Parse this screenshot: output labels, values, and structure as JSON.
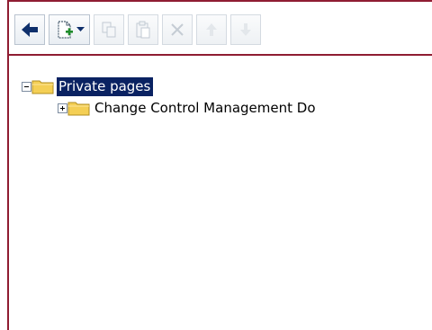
{
  "toolbar": {
    "buttons": [
      {
        "name": "back-button",
        "icon": "arrow-left-icon",
        "enabled": true
      },
      {
        "name": "new-page-dropdown-button",
        "icon": "new-document-plus-icon",
        "enabled": true
      },
      {
        "name": "copy-button",
        "icon": "copy-icon",
        "enabled": false
      },
      {
        "name": "paste-button",
        "icon": "paste-icon",
        "enabled": false
      },
      {
        "name": "delete-button",
        "icon": "x-icon",
        "enabled": false
      },
      {
        "name": "move-up-button",
        "icon": "arrow-up-icon",
        "enabled": false
      },
      {
        "name": "move-down-button",
        "icon": "arrow-down-icon",
        "enabled": false
      }
    ]
  },
  "tree": {
    "root": {
      "label": "Private pages",
      "expanded": true,
      "selected": true
    },
    "children": [
      {
        "label": "Change Control Management Do",
        "expanded": false
      }
    ]
  },
  "colors": {
    "frame": "#8f1d32",
    "selection": "#0a2262",
    "folder": "#f4cf55"
  }
}
